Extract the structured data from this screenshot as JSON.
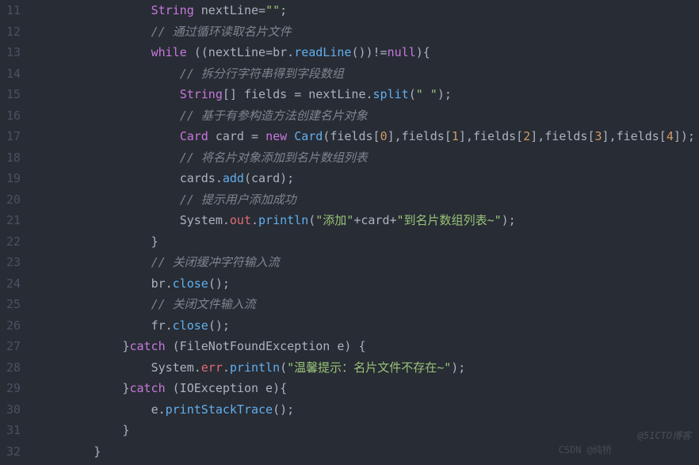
{
  "gutter": {
    "start": 11,
    "end": 32
  },
  "watermark1": "@51CTO博客",
  "watermark2": "CSDN @纯桥",
  "code": [
    {
      "indent": "                ",
      "tokens": [
        {
          "c": "typ",
          "t": "String"
        },
        {
          "c": "pln",
          "t": " nextLine"
        },
        {
          "c": "op",
          "t": "="
        },
        {
          "c": "str",
          "t": "\"\""
        },
        {
          "c": "op",
          "t": ";"
        }
      ]
    },
    {
      "indent": "                ",
      "tokens": [
        {
          "c": "cmt",
          "t": "// 通过循环读取名片文件"
        }
      ]
    },
    {
      "indent": "                ",
      "tokens": [
        {
          "c": "kw",
          "t": "while"
        },
        {
          "c": "pln",
          "t": " ((nextLine"
        },
        {
          "c": "op",
          "t": "="
        },
        {
          "c": "pln",
          "t": "br."
        },
        {
          "c": "mtd",
          "t": "readLine"
        },
        {
          "c": "pln",
          "t": "())"
        },
        {
          "c": "op",
          "t": "!="
        },
        {
          "c": "kw",
          "t": "null"
        },
        {
          "c": "pln",
          "t": "){"
        }
      ]
    },
    {
      "indent": "                    ",
      "tokens": [
        {
          "c": "cmt",
          "t": "// 拆分行字符串得到字段数组"
        }
      ]
    },
    {
      "indent": "                    ",
      "tokens": [
        {
          "c": "typ",
          "t": "String"
        },
        {
          "c": "pln",
          "t": "[] fields "
        },
        {
          "c": "op",
          "t": "= "
        },
        {
          "c": "pln",
          "t": "nextLine."
        },
        {
          "c": "mtd",
          "t": "split"
        },
        {
          "c": "pln",
          "t": "("
        },
        {
          "c": "str",
          "t": "\" \""
        },
        {
          "c": "pln",
          "t": ");"
        }
      ]
    },
    {
      "indent": "                    ",
      "tokens": [
        {
          "c": "cmt",
          "t": "// 基于有参构造方法创建名片对象"
        }
      ]
    },
    {
      "indent": "                    ",
      "tokens": [
        {
          "c": "typ",
          "t": "Card"
        },
        {
          "c": "pln",
          "t": " card "
        },
        {
          "c": "op",
          "t": "= "
        },
        {
          "c": "kw",
          "t": "new"
        },
        {
          "c": "pln",
          "t": " "
        },
        {
          "c": "mtd",
          "t": "Card"
        },
        {
          "c": "pln",
          "t": "(fields["
        },
        {
          "c": "num",
          "t": "0"
        },
        {
          "c": "pln",
          "t": "],fields["
        },
        {
          "c": "num",
          "t": "1"
        },
        {
          "c": "pln",
          "t": "],fields["
        },
        {
          "c": "num",
          "t": "2"
        },
        {
          "c": "pln",
          "t": "],fields["
        },
        {
          "c": "num",
          "t": "3"
        },
        {
          "c": "pln",
          "t": "],fields["
        },
        {
          "c": "num",
          "t": "4"
        },
        {
          "c": "pln",
          "t": "]);"
        }
      ]
    },
    {
      "indent": "                    ",
      "tokens": [
        {
          "c": "cmt",
          "t": "// 将名片对象添加到名片数组列表"
        }
      ]
    },
    {
      "indent": "                    ",
      "tokens": [
        {
          "c": "pln",
          "t": "cards."
        },
        {
          "c": "mtd",
          "t": "add"
        },
        {
          "c": "pln",
          "t": "(card);"
        }
      ]
    },
    {
      "indent": "                    ",
      "tokens": [
        {
          "c": "cmt",
          "t": "// 提示用户添加成功"
        }
      ]
    },
    {
      "indent": "                    ",
      "tokens": [
        {
          "c": "pln",
          "t": "System."
        },
        {
          "c": "var",
          "t": "out"
        },
        {
          "c": "pln",
          "t": "."
        },
        {
          "c": "mtd",
          "t": "println"
        },
        {
          "c": "pln",
          "t": "("
        },
        {
          "c": "str",
          "t": "\"添加\""
        },
        {
          "c": "op",
          "t": "+"
        },
        {
          "c": "pln",
          "t": "card"
        },
        {
          "c": "op",
          "t": "+"
        },
        {
          "c": "str",
          "t": "\"到名片数组列表~\""
        },
        {
          "c": "pln",
          "t": ");"
        }
      ]
    },
    {
      "indent": "                ",
      "tokens": [
        {
          "c": "pln",
          "t": "}"
        }
      ]
    },
    {
      "indent": "                ",
      "tokens": [
        {
          "c": "cmt",
          "t": "// 关闭缓冲字符输入流"
        }
      ]
    },
    {
      "indent": "                ",
      "tokens": [
        {
          "c": "pln",
          "t": "br."
        },
        {
          "c": "mtd",
          "t": "close"
        },
        {
          "c": "pln",
          "t": "();"
        }
      ]
    },
    {
      "indent": "                ",
      "tokens": [
        {
          "c": "cmt",
          "t": "// 关闭文件输入流"
        }
      ]
    },
    {
      "indent": "                ",
      "tokens": [
        {
          "c": "pln",
          "t": "fr."
        },
        {
          "c": "mtd",
          "t": "close"
        },
        {
          "c": "pln",
          "t": "();"
        }
      ]
    },
    {
      "indent": "            ",
      "tokens": [
        {
          "c": "pln",
          "t": "}"
        },
        {
          "c": "kw",
          "t": "catch"
        },
        {
          "c": "pln",
          "t": " (FileNotFoundException e) {"
        }
      ]
    },
    {
      "indent": "                ",
      "tokens": [
        {
          "c": "pln",
          "t": "System."
        },
        {
          "c": "var",
          "t": "err"
        },
        {
          "c": "pln",
          "t": "."
        },
        {
          "c": "mtd",
          "t": "println"
        },
        {
          "c": "pln",
          "t": "("
        },
        {
          "c": "str",
          "t": "\"温馨提示：名片文件不存在~\""
        },
        {
          "c": "pln",
          "t": ");"
        }
      ]
    },
    {
      "indent": "            ",
      "tokens": [
        {
          "c": "pln",
          "t": "}"
        },
        {
          "c": "kw",
          "t": "catch"
        },
        {
          "c": "pln",
          "t": " (IOException e){"
        }
      ]
    },
    {
      "indent": "                ",
      "tokens": [
        {
          "c": "pln",
          "t": "e."
        },
        {
          "c": "mtd",
          "t": "printStackTrace"
        },
        {
          "c": "pln",
          "t": "();"
        }
      ]
    },
    {
      "indent": "            ",
      "tokens": [
        {
          "c": "pln",
          "t": "}"
        }
      ]
    },
    {
      "indent": "        ",
      "tokens": [
        {
          "c": "pln",
          "t": "}"
        }
      ]
    }
  ]
}
